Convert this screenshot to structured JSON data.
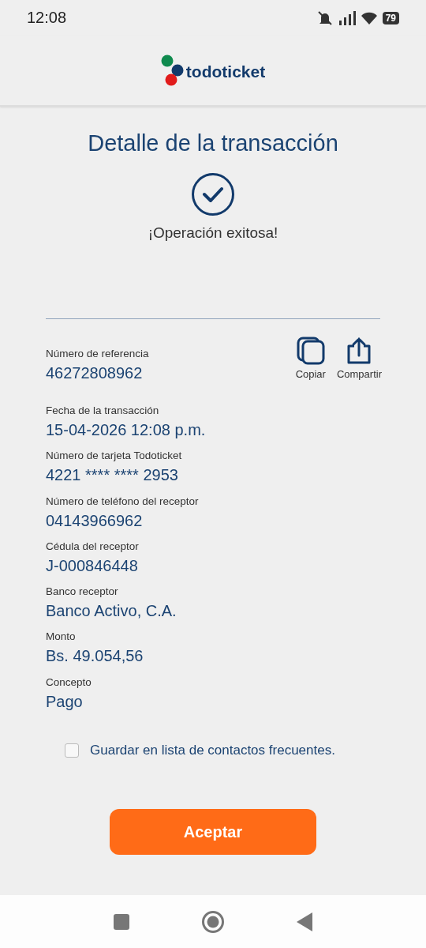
{
  "status_bar": {
    "time": "12:08",
    "battery": "79"
  },
  "header": {
    "logo": "todoticket"
  },
  "title": "Detalle de la transacción",
  "result": "¡Operación exitosa!",
  "reference": {
    "label": "Número de referencia",
    "value": "46272808962"
  },
  "actions": [
    {
      "label": "Copiar",
      "kind": "copy"
    },
    {
      "label": "Compartir",
      "kind": "share"
    }
  ],
  "fields": [
    {
      "label": "Fecha de la transacción",
      "value": "15-04-2026 12:08 p.m."
    },
    {
      "label": "Número de tarjeta Todoticket",
      "value": "4221 **** **** 2953"
    },
    {
      "label": "Número de teléfono del receptor",
      "value": "04143966962"
    },
    {
      "label": "Cédula del receptor",
      "value": "J-000846448"
    },
    {
      "label": "Banco receptor",
      "value": "Banco Activo, C.A."
    },
    {
      "label": "Monto",
      "value": "Bs. 49.054,56"
    },
    {
      "label": "Concepto",
      "value": "Pago"
    }
  ],
  "save_contact": {
    "label": "Guardar en lista de contactos frecuentes.",
    "checked": false
  },
  "button": "Aceptar"
}
